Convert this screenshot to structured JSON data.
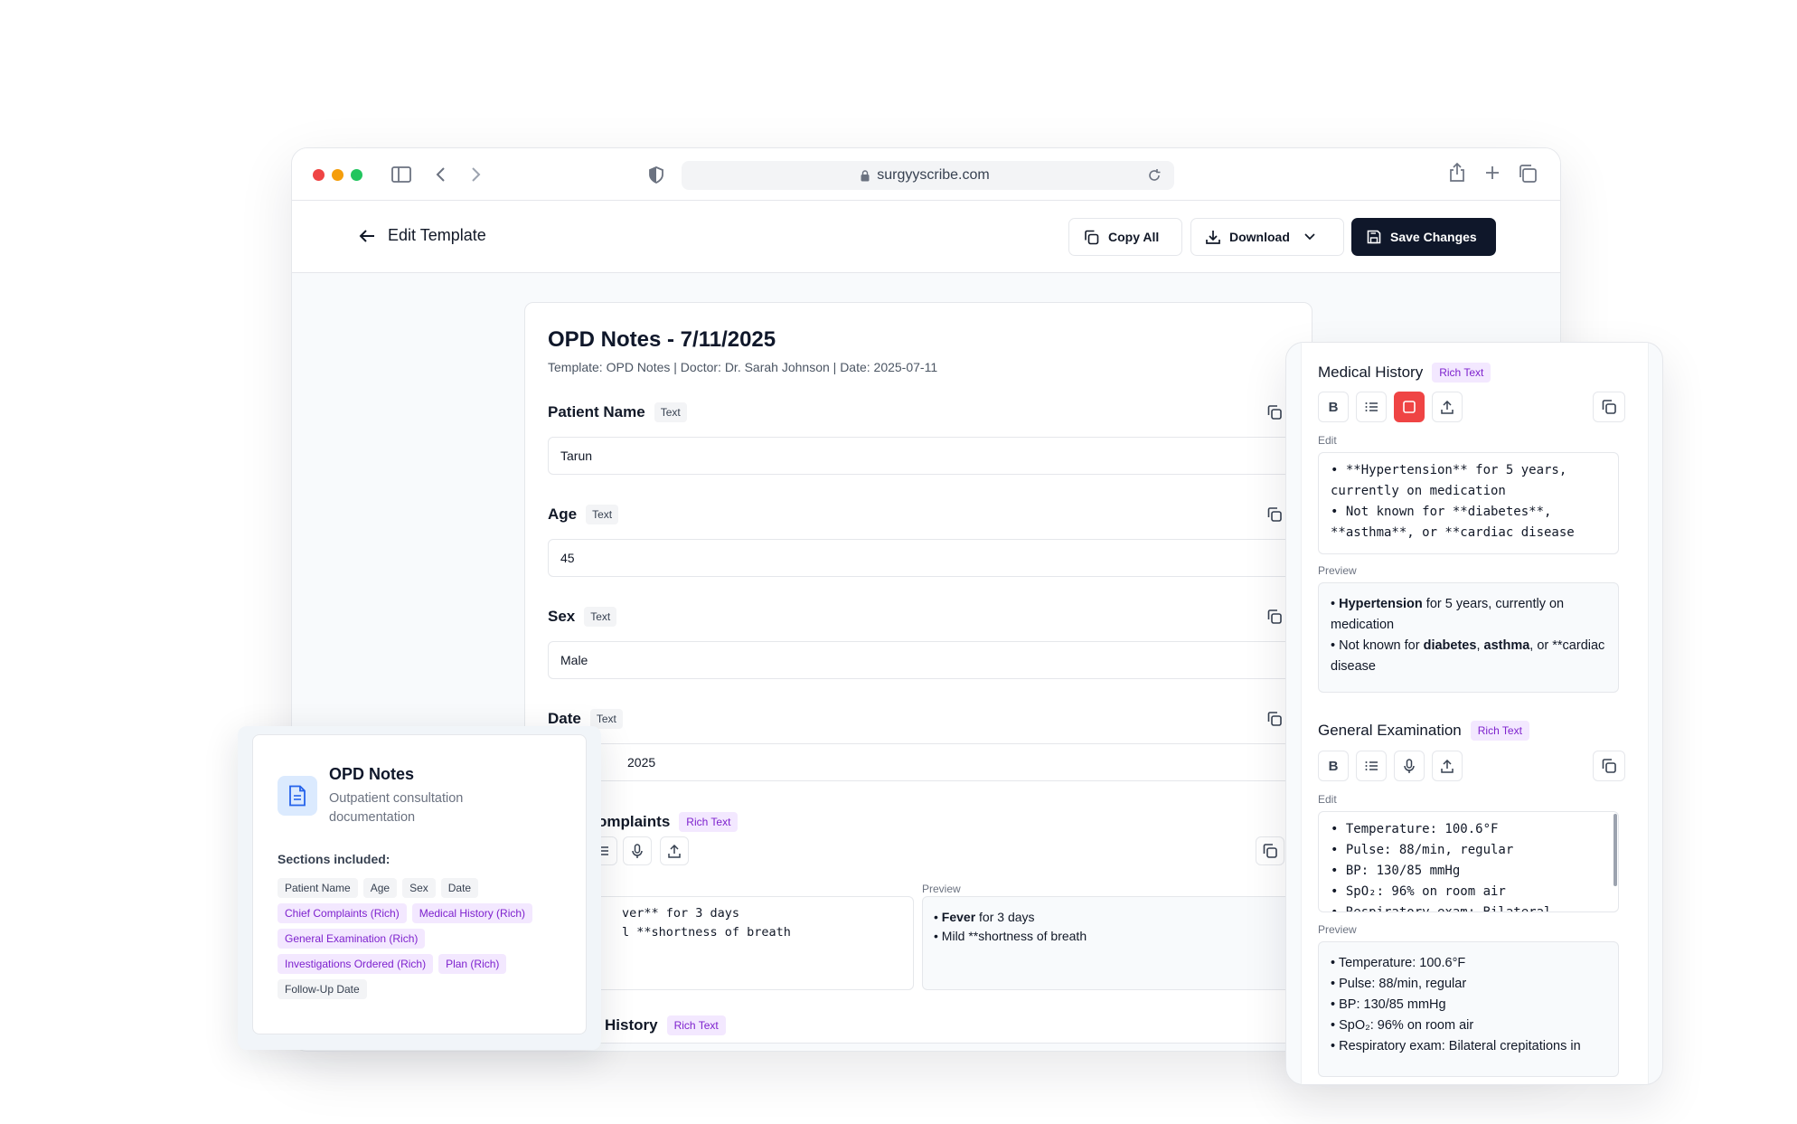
{
  "browser": {
    "url": "surgyyscribe.com",
    "traffic_lights": [
      "#ef4444",
      "#f59e0b",
      "#22c55e"
    ]
  },
  "header": {
    "back_label": "Edit Template",
    "copy_all_label": "Copy All",
    "download_label": "Download",
    "save_label": "Save Changes"
  },
  "document": {
    "title": "OPD Notes - 7/11/2025",
    "subtitle": "Template: OPD Notes | Doctor: Dr. Sarah Johnson | Date: 2025-07-11",
    "fields": [
      {
        "label": "Patient Name",
        "type": "Text",
        "value": "Tarun"
      },
      {
        "label": "Age",
        "type": "Text",
        "value": "45"
      },
      {
        "label": "Sex",
        "type": "Text",
        "value": "Male"
      },
      {
        "label": "Date",
        "type": "Text",
        "value": "2025"
      }
    ],
    "chief_complaints": {
      "label": "omplaints",
      "type": "Rich Text",
      "edit_lines": [
        "ver** for 3 days",
        "l **shortness of breath"
      ],
      "preview_label": "Preview",
      "preview_lines": [
        {
          "bold": "Fever",
          "rest": " for 3 days"
        },
        {
          "bold": "",
          "rest": "Mild **shortness of breath"
        }
      ]
    },
    "next_section": {
      "label": "History",
      "type": "Rich Text"
    }
  },
  "template_card": {
    "title": "OPD Notes",
    "description": "Outpatient consultation documentation",
    "sections_label": "Sections included:",
    "sections": [
      {
        "name": "Patient Name",
        "rich": false
      },
      {
        "name": "Age",
        "rich": false
      },
      {
        "name": "Sex",
        "rich": false
      },
      {
        "name": "Date",
        "rich": false
      },
      {
        "name": "Chief Complaints (Rich)",
        "rich": true
      },
      {
        "name": "Medical History (Rich)",
        "rich": true
      },
      {
        "name": "General Examination (Rich)",
        "rich": true
      },
      {
        "name": "Investigations Ordered (Rich)",
        "rich": true
      },
      {
        "name": "Plan (Rich)",
        "rich": true
      },
      {
        "name": "Follow-Up Date",
        "rich": false
      }
    ]
  },
  "side_panel": {
    "medical_history": {
      "title": "Medical History",
      "type": "Rich Text",
      "edit_label": "Edit",
      "edit_lines": [
        "• **Hypertension** for 5 years,",
        "currently on medication",
        "• Not known for **diabetes**,",
        "**asthma**, or **cardiac disease"
      ],
      "preview_label": "Preview"
    },
    "general_examination": {
      "title": "General Examination",
      "type": "Rich Text",
      "edit_label": "Edit",
      "edit_lines": [
        "• Temperature: 100.6°F",
        "• Pulse: 88/min, regular",
        "• BP: 130/85 mmHg",
        "• SpO₂: 96% on room air",
        "• Respiratory exam: Bilateral"
      ],
      "preview_label": "Preview",
      "preview_lines": [
        "• Temperature: 100.6°F",
        "• Pulse: 88/min, regular",
        "• BP: 130/85 mmHg",
        "• SpO₂: 96% on room air",
        "• Respiratory exam: Bilateral crepitations in"
      ]
    }
  }
}
